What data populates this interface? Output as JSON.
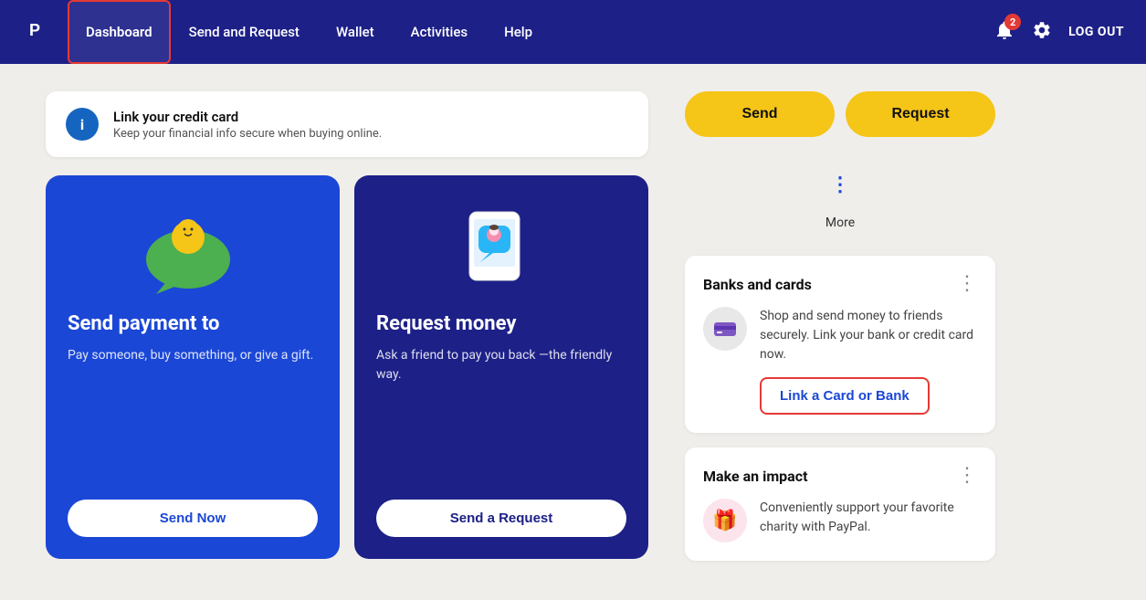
{
  "navbar": {
    "logo_alt": "PayPal",
    "items": [
      {
        "id": "dashboard",
        "label": "Dashboard",
        "active": true
      },
      {
        "id": "send-and-request",
        "label": "Send and Request",
        "active": false
      },
      {
        "id": "wallet",
        "label": "Wallet",
        "active": false
      },
      {
        "id": "activities",
        "label": "Activities",
        "active": false
      },
      {
        "id": "help",
        "label": "Help",
        "active": false
      }
    ],
    "notification_count": "2",
    "logout_label": "LOG OUT"
  },
  "banner": {
    "title": "Link your credit card",
    "subtitle": "Keep your financial info secure when buying online."
  },
  "send_card": {
    "title": "Send payment to",
    "description": "Pay someone, buy something, or give a gift.",
    "button_label": "Send Now"
  },
  "request_card": {
    "title": "Request money",
    "description": "Ask a friend to pay you back —the friendly way.",
    "button_label": "Send a Request"
  },
  "actions": {
    "send_label": "Send",
    "request_label": "Request",
    "more_label": "More"
  },
  "banks_section": {
    "title": "Banks and cards",
    "description": "Shop and send money to friends securely. Link your bank or credit card now.",
    "link_label": "Link a Card or Bank"
  },
  "impact_section": {
    "title": "Make an impact",
    "description": "Conveniently support your favorite charity with PayPal."
  }
}
